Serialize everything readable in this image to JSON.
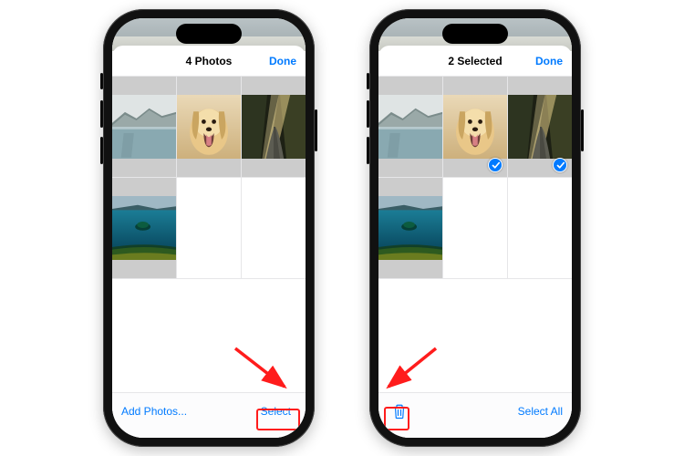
{
  "colors": {
    "ios_blue": "#007aff",
    "highlight_red": "#ff1c1c"
  },
  "phones": [
    {
      "header": {
        "title": "4 Photos",
        "done": "Done"
      },
      "bottom": {
        "left_label": "Add Photos...",
        "right_label": "Select",
        "mode": "labels"
      },
      "photos": [
        {
          "name": "lake-mountain",
          "selected": false
        },
        {
          "name": "dog-golden",
          "selected": false
        },
        {
          "name": "forest-road",
          "selected": false
        },
        {
          "name": "island-sea",
          "selected": false
        }
      ],
      "highlight": "right",
      "arrow_direction": "to-right"
    },
    {
      "header": {
        "title": "2 Selected",
        "done": "Done"
      },
      "bottom": {
        "right_label": "Select All",
        "mode": "trash-and-label",
        "icon": "trash-icon"
      },
      "photos": [
        {
          "name": "lake-mountain",
          "selected": false
        },
        {
          "name": "dog-golden",
          "selected": true
        },
        {
          "name": "forest-road",
          "selected": true
        },
        {
          "name": "island-sea",
          "selected": false
        }
      ],
      "highlight": "left",
      "arrow_direction": "to-left"
    }
  ]
}
